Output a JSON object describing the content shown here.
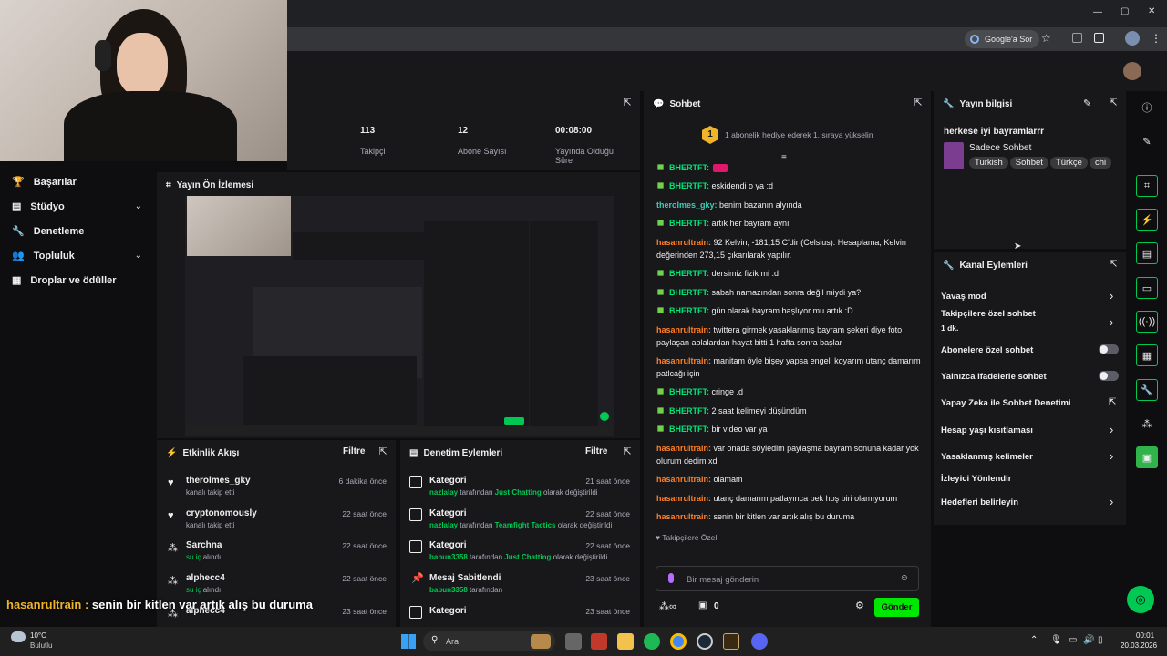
{
  "browser": {
    "window_controls": [
      "—",
      "▢",
      "✕"
    ],
    "google_search_label": "Google'a Sor"
  },
  "stats": {
    "followers_value": "113",
    "followers_label": "Takipçi",
    "subs_value": "12",
    "subs_label": "Abone Sayısı",
    "time_value": "00:08:00",
    "time_label_1": "Yayında Olduğu",
    "time_label_2": "Süre"
  },
  "sidebar": {
    "items": [
      {
        "label": "Başarılar"
      },
      {
        "label": "Stüdyo"
      },
      {
        "label": "Denetleme"
      },
      {
        "label": "Topluluk"
      },
      {
        "label": "Droplar ve ödüller"
      }
    ]
  },
  "preview": {
    "title": "Yayın Ön İzlemesi"
  },
  "chat": {
    "title": "Sohbet",
    "hype_num": "1",
    "hype_text": "1 abonelik hediye ederek 1. sıraya yükselin",
    "messages": [
      {
        "user": "BHERTFT:",
        "text": ""
      },
      {
        "user": "BHERTFT:",
        "text": "eskidendi o ya :d"
      },
      {
        "user": "therolmes_gky:",
        "text": "benim bazanın alyında"
      },
      {
        "user": "BHERTFT:",
        "text": "artık her bayram aynı"
      },
      {
        "user": "hasanrultrain:",
        "text": "92 Kelvin, -181,15 C'dir (Celsius). Hesaplama, Kelvin değerinden 273,15 çıkarılarak yapılır."
      },
      {
        "user": "BHERTFT:",
        "text": "dersimiz fizik mi .d"
      },
      {
        "user": "BHERTFT:",
        "text": "sabah namazından sonra değil miydi ya?"
      },
      {
        "user": "BHERTFT:",
        "text": "gün olarak bayram başlıyor mu artık :D"
      },
      {
        "user": "hasanrultrain:",
        "text": "twittera girmek yasaklanmış bayram şekeri diye foto paylaşan ablalardan hayat bitti 1 hafta sonra başlar"
      },
      {
        "user": "hasanrultrain:",
        "text": "manitam öyle bişey yapsa engeli koyarım utanç damarım patlcağı için"
      },
      {
        "user": "BHERTFT:",
        "text": "cringe .d"
      },
      {
        "user": "BHERTFT:",
        "text": "2 saat kelimeyi düşündüm"
      },
      {
        "user": "BHERTFT:",
        "text": "bir video var ya"
      },
      {
        "user": "hasanrultrain:",
        "text": "var onada söyledim paylaşma bayram sonuna kadar yok olurum dedim xd"
      },
      {
        "user": "hasanrultrain:",
        "text": "olamam"
      },
      {
        "user": "hasanrultrain:",
        "text": "utanç damarım patlayınca pek hoş biri olamıyorum"
      },
      {
        "user": "hasanrultrain:",
        "text": "senin bir kitlen var artık alış bu duruma"
      }
    ],
    "followers_only": "Takipçilere Özel",
    "input_placeholder": "Bir mesaj gönderin",
    "points": "0",
    "send_label": "Gönder"
  },
  "stream_info": {
    "title": "Yayın bilgisi",
    "stream_title": "herkese iyi bayramlarrr",
    "category": "Sadece Sohbet",
    "tags": [
      "Turkish",
      "Sohbet",
      "Türkçe",
      "chi"
    ]
  },
  "channel_actions": {
    "title": "Kanal Eylemleri",
    "items": [
      {
        "label": "Yavaş mod",
        "control": "chevron"
      },
      {
        "label": "Takipçilere özel sohbet",
        "sub": "1 dk.",
        "control": "chevron"
      },
      {
        "label": "Abonelere özel sohbet",
        "control": "toggle"
      },
      {
        "label": "Yalnızca ifadelerle sohbet",
        "control": "toggle"
      },
      {
        "label": "Yapay Zeka ile Sohbet Denetimi",
        "control": "external"
      },
      {
        "label": "Hesap yaşı kısıtlaması",
        "control": "chevron"
      },
      {
        "label": "Yasaklanmış kelimeler",
        "control": "chevron"
      },
      {
        "label": "İzleyici Yönlendir",
        "control": "none"
      },
      {
        "label": "Hedefleri belirleyin",
        "control": "chevron"
      }
    ]
  },
  "activity": {
    "title": "Etkinlik Akışı",
    "filter": "Filtre",
    "items": [
      {
        "name": "therolmes_gky",
        "sub": "kanalı takip etti",
        "time": "6 dakika önce",
        "icon": "heart-icon"
      },
      {
        "name": "cryptonomously",
        "sub": "kanalı takip etti",
        "time": "22 saat önce",
        "icon": "heart-icon"
      },
      {
        "name": "Sarchna",
        "sub_green": "su iç",
        "sub": "alındı",
        "time": "22 saat önce",
        "icon": "points-icon"
      },
      {
        "name": "alphecc4",
        "sub_green": "su iç",
        "sub": "alındı",
        "time": "22 saat önce",
        "icon": "points-icon"
      },
      {
        "name": "alphecc4",
        "sub": "",
        "time": "23 saat önce",
        "icon": "points-icon"
      }
    ]
  },
  "mod_actions": {
    "title": "Denetim Eylemleri",
    "filter": "Filtre",
    "items": [
      {
        "name": "Kategori",
        "user": "nazlalay",
        "mid": "tarafından",
        "cat": "Just Chatting",
        "end": "olarak değiştirildi",
        "time": "21 saat önce"
      },
      {
        "name": "Kategori",
        "user": "nazlalay",
        "mid": "tarafından",
        "cat": "Teamfight Tactics",
        "end": "olarak değiştirildi",
        "time": "22 saat önce"
      },
      {
        "name": "Kategori",
        "user": "babun3358",
        "mid": "tarafından",
        "cat": "Just Chatting",
        "end": "olarak değiştirildi",
        "time": "22 saat önce"
      },
      {
        "name": "Mesaj Sabitlendi",
        "user": "babun3358",
        "mid": "tarafından",
        "cat": "",
        "end": "",
        "time": "23 saat önce"
      },
      {
        "name": "Kategori",
        "user": "",
        "mid": "",
        "cat": "",
        "end": "",
        "time": "23 saat önce"
      }
    ]
  },
  "overlay_caption": {
    "user": "hasanrultrain :",
    "text": "senin bir kitlen var artık alış bu duruma"
  },
  "taskbar": {
    "weather_temp": "10°C",
    "weather_desc": "Bulutlu",
    "search_placeholder": "Ara",
    "time": "00:01",
    "date": "20.03.2026"
  },
  "colors": {
    "accent": "#00e701",
    "bg": "#0e0e10",
    "panel": "#18181b",
    "orange": "#ff7f27",
    "teal": "#35d1b5"
  }
}
